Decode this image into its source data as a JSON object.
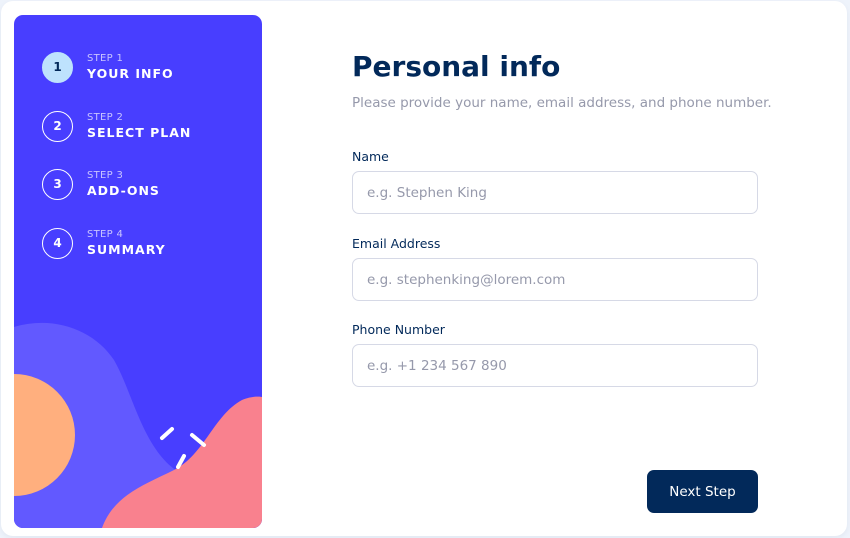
{
  "colors": {
    "sidebar_bg": "#483eff",
    "active_step_bg": "#bee2fd",
    "primary_text": "#02295a",
    "muted_text": "#9699ab",
    "button_bg": "#02295a",
    "blob_light": "#6259ff",
    "blob_orange": "#ffaf7e",
    "blob_pink": "#f9818e"
  },
  "sidebar": {
    "steps": [
      {
        "label": "STEP 1",
        "title": "YOUR INFO",
        "number": "1",
        "active": true
      },
      {
        "label": "STEP 2",
        "title": "SELECT PLAN",
        "number": "2",
        "active": false
      },
      {
        "label": "STEP 3",
        "title": "ADD-ONS",
        "number": "3",
        "active": false
      },
      {
        "label": "STEP 4",
        "title": "SUMMARY",
        "number": "4",
        "active": false
      }
    ]
  },
  "form": {
    "title": "Personal info",
    "subtitle": "Please provide your name, email address, and phone number.",
    "fields": [
      {
        "label": "Name",
        "placeholder": "e.g. Stephen King",
        "value": ""
      },
      {
        "label": "Email Address",
        "placeholder": "e.g. stephenking@lorem.com",
        "value": ""
      },
      {
        "label": "Phone Number",
        "placeholder": "e.g. +1 234 567 890",
        "value": ""
      }
    ],
    "next_label": "Next Step"
  }
}
